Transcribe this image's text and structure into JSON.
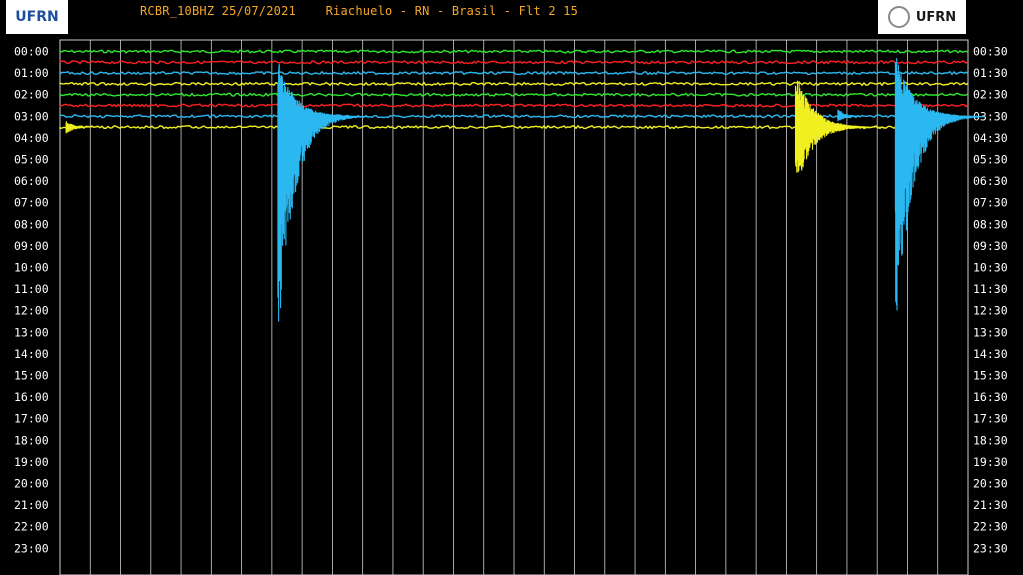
{
  "header": {
    "title": "RCBR_10BHZ 25/07/2021    Riachuelo - RN - Brasil - Flt 2 15",
    "logo_left_text": "UFRN",
    "logo_right_text": "UFRN"
  },
  "chart_data": {
    "type": "line",
    "title": "RCBR_10BHZ 25/07/2021    Riachuelo - RN - Brasil - Flt 2 15",
    "xlabel": "",
    "ylabel": "",
    "y_left_ticks": [
      "00:00",
      "01:00",
      "02:00",
      "03:00",
      "04:00",
      "05:00",
      "06:00",
      "07:00",
      "08:00",
      "09:00",
      "10:00",
      "11:00",
      "12:00",
      "13:00",
      "14:00",
      "15:00",
      "16:00",
      "17:00",
      "18:00",
      "19:00",
      "20:00",
      "21:00",
      "22:00",
      "23:00"
    ],
    "y_right_ticks": [
      "00:30",
      "01:30",
      "02:30",
      "03:30",
      "04:30",
      "05:30",
      "06:30",
      "07:30",
      "08:30",
      "09:30",
      "10:30",
      "11:30",
      "12:30",
      "13:30",
      "14:30",
      "15:30",
      "16:30",
      "17:30",
      "18:30",
      "19:30",
      "20:30",
      "21:30",
      "22:30",
      "23:30"
    ],
    "x_range": [
      0,
      30
    ],
    "vertical_grid_count": 30,
    "grid": true,
    "trace_colors": [
      "#2ee82e",
      "#ff2020",
      "#2bb8f0",
      "#f0f020"
    ],
    "active_rows": 8,
    "partial_row_end_fraction": 0.93,
    "events": [
      {
        "x": 0.2,
        "row": 7,
        "color": "#f0f020",
        "amplitude_up": 0.6,
        "amplitude_down": 0.7
      },
      {
        "x": 7.2,
        "row": 6,
        "color": "#2bb8f0",
        "amplitude_up": 5.5,
        "amplitude_down": 21
      },
      {
        "x": 24.3,
        "row": 7,
        "color": "#f0f020",
        "amplitude_up": 5.5,
        "amplitude_down": 6
      },
      {
        "x": 25.7,
        "row": 6,
        "color": "#2bb8f0",
        "amplitude_up": 0.7,
        "amplitude_down": 0.5
      },
      {
        "x": 27.6,
        "row": 6,
        "color": "#2bb8f0",
        "amplitude_up": 6,
        "amplitude_down": 21
      }
    ]
  }
}
